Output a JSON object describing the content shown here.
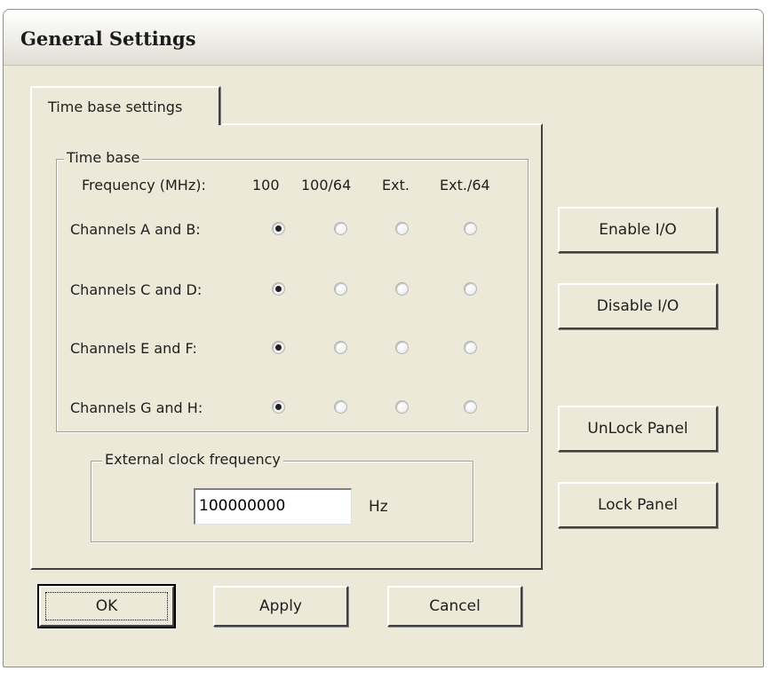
{
  "window": {
    "title": "General Settings"
  },
  "tab": {
    "label": "Time base settings"
  },
  "time_base": {
    "group_title": "Time base",
    "frequency_label": "Frequency (MHz):",
    "columns": [
      "100",
      "100/64",
      "Ext.",
      "Ext./64"
    ],
    "rows": [
      {
        "label": "Channels A and B:",
        "selected": 0
      },
      {
        "label": "Channels C and D:",
        "selected": 0
      },
      {
        "label": "Channels E and F:",
        "selected": 0
      },
      {
        "label": "Channels G and H:",
        "selected": 0
      }
    ]
  },
  "external_clock": {
    "group_title": "External clock frequency",
    "value": "100000000",
    "unit": "Hz"
  },
  "side_buttons": {
    "enable_io": "Enable I/O",
    "disable_io": "Disable I/O",
    "unlock_panel": "UnLock Panel",
    "lock_panel": "Lock Panel"
  },
  "footer_buttons": {
    "ok": "OK",
    "apply": "Apply",
    "cancel": "Cancel"
  }
}
